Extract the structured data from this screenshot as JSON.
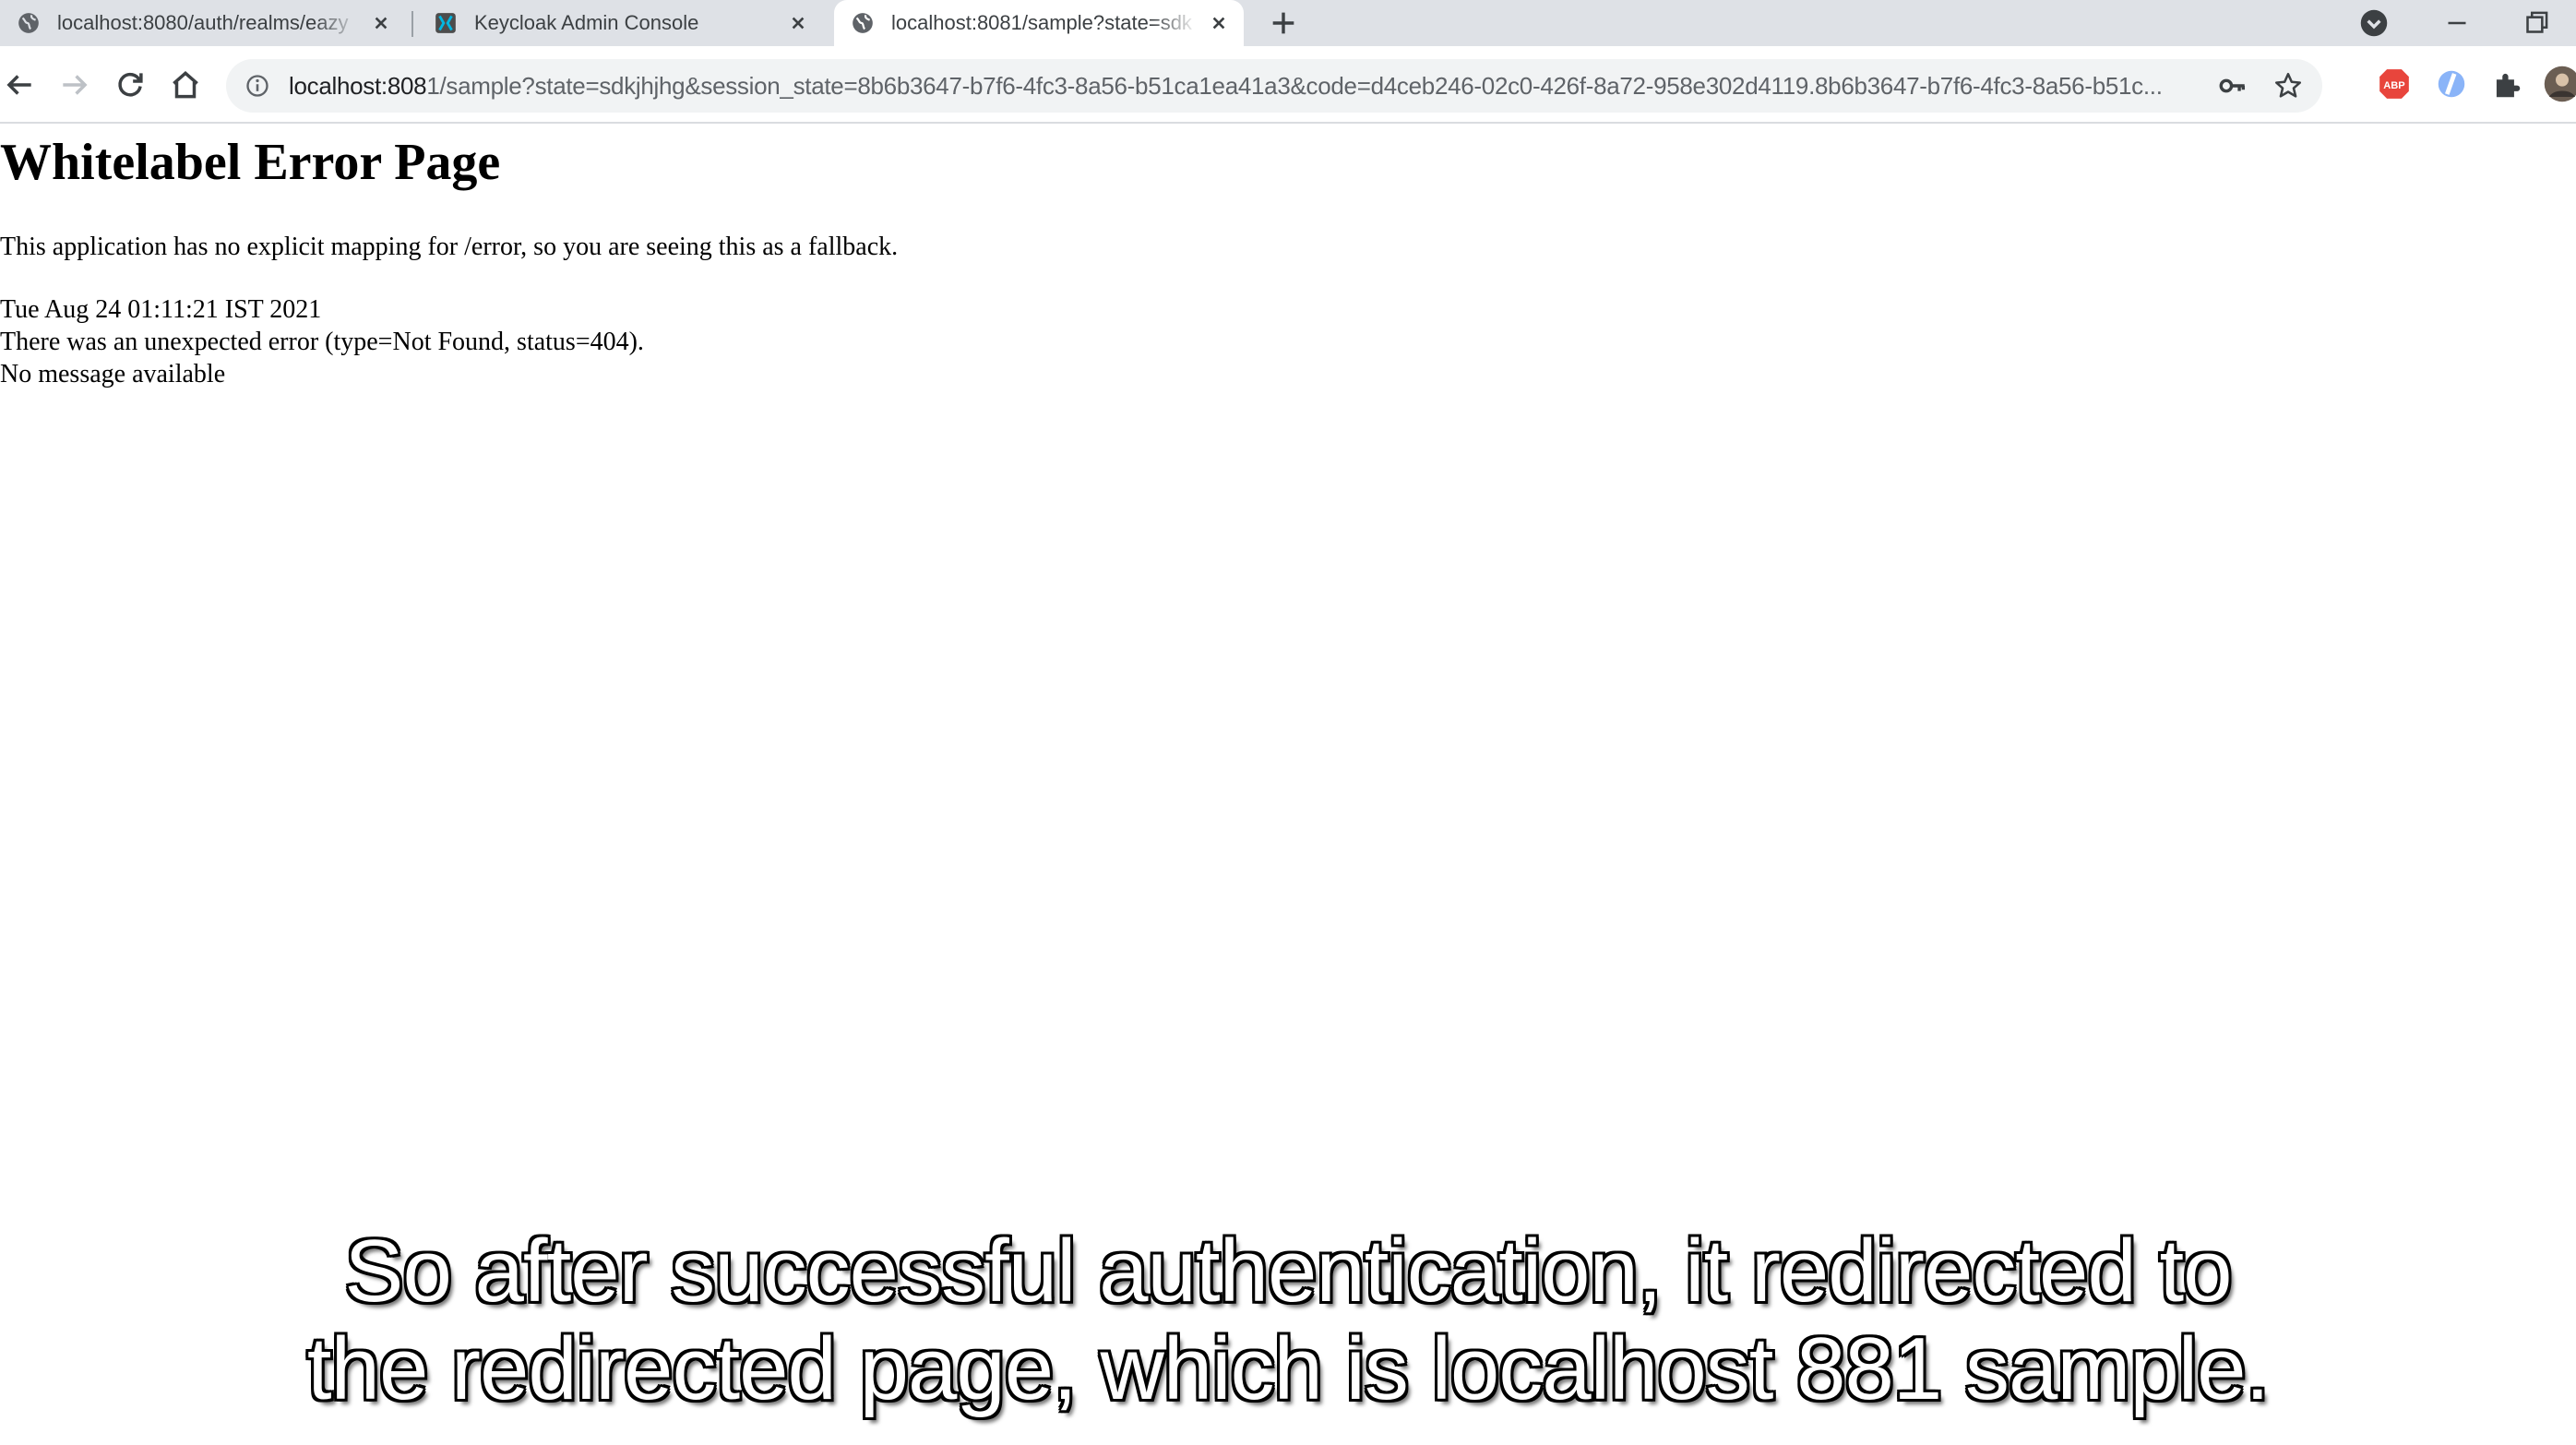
{
  "tabs": [
    {
      "title": "localhost:8080/auth/realms/eazy",
      "icon": "globe-icon",
      "active": false
    },
    {
      "title": "Keycloak Admin Console",
      "icon": "keycloak-icon",
      "active": false
    },
    {
      "title": "localhost:8081/sample?state=sdk",
      "icon": "globe-icon",
      "active": true
    }
  ],
  "omnibox": {
    "url_host": "localhost:808",
    "url_rest": "1/sample?state=sdkjhjhg&session_state=8b6b3647-b7f6-4fc3-8a56-b51ca1ea41a3&code=d4ceb246-02c0-426f-8a72-958e302d4119.8b6b3647-b7f6-4fc3-8a56-b51c..."
  },
  "page": {
    "title": "Whitelabel Error Page",
    "description": "This application has no explicit mapping for /error, so you are seeing this as a fallback.",
    "timestamp": "Tue Aug 24 01:11:21 IST 2021",
    "error": "There was an unexpected error (type=Not Found, status=404).",
    "message": "No message available"
  },
  "caption": {
    "line1": "So after successful authentication, it redirected to",
    "line2": "the redirected page, which is localhost 881 sample."
  },
  "colors": {
    "tabstrip": "#dee1e6",
    "omnibox": "#f1f3f4",
    "abp_badge": "#e8453c"
  }
}
